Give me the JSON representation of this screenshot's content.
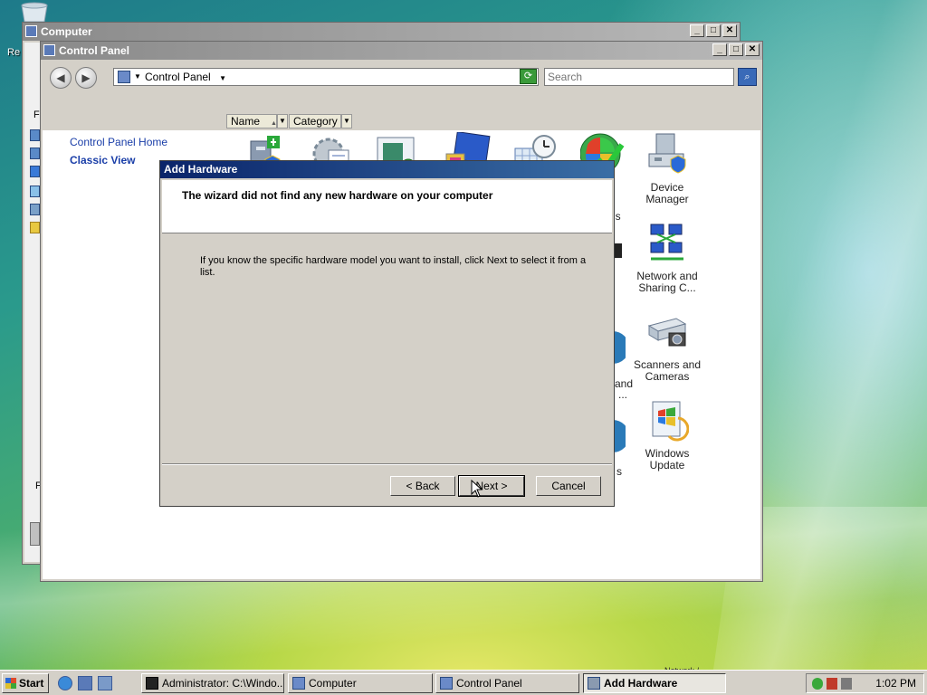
{
  "desktop": {
    "recycle_label": "Re"
  },
  "computer_window": {
    "title": "Computer",
    "side_letters": [
      "Fa",
      "F"
    ]
  },
  "control_panel": {
    "title": "Control Panel",
    "address": "Control Panel",
    "search_placeholder": "Search",
    "columns": {
      "name": "Name",
      "category": "Category"
    },
    "nav": {
      "home": "Control Panel Home",
      "classic": "Classic View"
    },
    "items": [
      {
        "label": "Device Manager",
        "icon": "device-manager-icon"
      },
      {
        "label": "Network and Sharing C...",
        "icon": "network-icon"
      },
      {
        "label": "Scanners and Cameras",
        "icon": "scanner-icon"
      },
      {
        "label": "Windows Update",
        "icon": "windows-update-icon"
      }
    ],
    "partial_labels": [
      "ls",
      "and",
      "...",
      "s"
    ]
  },
  "dialog": {
    "title": "Add Hardware",
    "heading": "The wizard did not find any new hardware on your computer",
    "body": "If you know the specific hardware model you want to install, click Next to select it from a list.",
    "buttons": {
      "back": "< Back",
      "next": "Next >",
      "cancel": "Cancel"
    }
  },
  "taskbar": {
    "start": "Start",
    "buttons": [
      {
        "label": "Administrator: C:\\Windo..."
      },
      {
        "label": "Computer"
      },
      {
        "label": "Control Panel"
      },
      {
        "label": "Add Hardware"
      }
    ],
    "clock": "1:02 PM",
    "network_tip": "Network /"
  }
}
